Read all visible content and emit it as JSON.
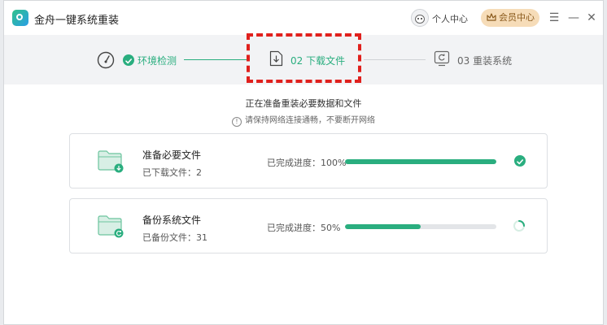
{
  "app": {
    "title": "金舟一键系统重装"
  },
  "header": {
    "user_center": "个人中心",
    "vip": "会员中心"
  },
  "window_controls": {
    "menu": "☰",
    "minimize": "—",
    "close": "✕"
  },
  "steps": [
    {
      "label": "环境检测",
      "state": "done"
    },
    {
      "label": "02 下载文件",
      "state": "active"
    },
    {
      "label": "03 重装系统",
      "state": "pending"
    }
  ],
  "status": {
    "main": "正在准备重装必要数据和文件",
    "sub": "请保持网络连接通畅，不要断开网络"
  },
  "tasks": [
    {
      "title": "准备必要文件",
      "detail": "已下载文件：2",
      "progress_text": "已完成进度：100%",
      "progress": 1.0,
      "state": "done"
    },
    {
      "title": "备份系统文件",
      "detail": "已备份文件：31",
      "progress_text": "已完成进度：50%",
      "progress": 0.5,
      "state": "in-progress"
    }
  ],
  "colors": {
    "accent": "#2aae7f",
    "highlight": "#e0201d",
    "vip_bg": "#f6dcb8"
  }
}
